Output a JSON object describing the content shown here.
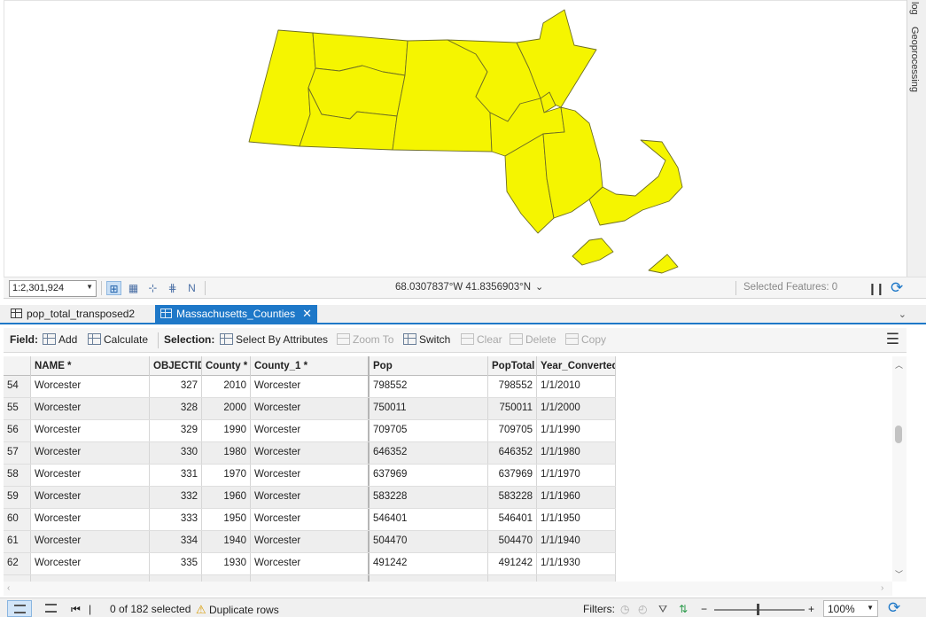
{
  "map": {
    "scale": "1:2,301,924",
    "coordinates": "68.0307837°W 41.8356903°N",
    "selected_features": "Selected Features: 0",
    "fill_color": "#f5f500",
    "outline_color": "#6e6e24",
    "dock_tabs": [
      "log",
      "Geoprocessing"
    ]
  },
  "tabs": {
    "items": [
      {
        "label": "pop_total_transposed2",
        "active": false
      },
      {
        "label": "Massachusetts_Counties",
        "active": true
      }
    ],
    "accent": "#1e78c8"
  },
  "toolbar": {
    "field_label": "Field:",
    "add": "Add",
    "calculate": "Calculate",
    "selection_label": "Selection:",
    "select_by_attributes": "Select By Attributes",
    "zoom_to": "Zoom To",
    "switch": "Switch",
    "clear": "Clear",
    "delete": "Delete",
    "copy": "Copy"
  },
  "table": {
    "columns": [
      "NAME *",
      "OBJECTID",
      "County *",
      "County_1 *",
      "Pop",
      "PopTotal",
      "Year_Converted"
    ],
    "rows": [
      {
        "rn": "54",
        "name": "Worcester",
        "oid": "327",
        "county": "2010",
        "county1": "Worcester",
        "pop": "798552",
        "poptotal": "798552",
        "year": "1/1/2010"
      },
      {
        "rn": "55",
        "name": "Worcester",
        "oid": "328",
        "county": "2000",
        "county1": "Worcester",
        "pop": "750011",
        "poptotal": "750011",
        "year": "1/1/2000"
      },
      {
        "rn": "56",
        "name": "Worcester",
        "oid": "329",
        "county": "1990",
        "county1": "Worcester",
        "pop": "709705",
        "poptotal": "709705",
        "year": "1/1/1990"
      },
      {
        "rn": "57",
        "name": "Worcester",
        "oid": "330",
        "county": "1980",
        "county1": "Worcester",
        "pop": "646352",
        "poptotal": "646352",
        "year": "1/1/1980"
      },
      {
        "rn": "58",
        "name": "Worcester",
        "oid": "331",
        "county": "1970",
        "county1": "Worcester",
        "pop": "637969",
        "poptotal": "637969",
        "year": "1/1/1970"
      },
      {
        "rn": "59",
        "name": "Worcester",
        "oid": "332",
        "county": "1960",
        "county1": "Worcester",
        "pop": "583228",
        "poptotal": "583228",
        "year": "1/1/1960"
      },
      {
        "rn": "60",
        "name": "Worcester",
        "oid": "333",
        "county": "1950",
        "county1": "Worcester",
        "pop": "546401",
        "poptotal": "546401",
        "year": "1/1/1950"
      },
      {
        "rn": "61",
        "name": "Worcester",
        "oid": "334",
        "county": "1940",
        "county1": "Worcester",
        "pop": "504470",
        "poptotal": "504470",
        "year": "1/1/1940"
      },
      {
        "rn": "62",
        "name": "Worcester",
        "oid": "335",
        "county": "1930",
        "county1": "Worcester",
        "pop": "491242",
        "poptotal": "491242",
        "year": "1/1/1930"
      },
      {
        "rn": "",
        "name": "",
        "oid": "",
        "county": "",
        "county1": "",
        "pop": "",
        "poptotal": "",
        "year": ""
      }
    ]
  },
  "status": {
    "selected": "0 of 182 selected",
    "duplicate": "Duplicate rows",
    "filters_label": "Filters:",
    "zoom": "100%",
    "zoom_fraction": 0.48
  }
}
